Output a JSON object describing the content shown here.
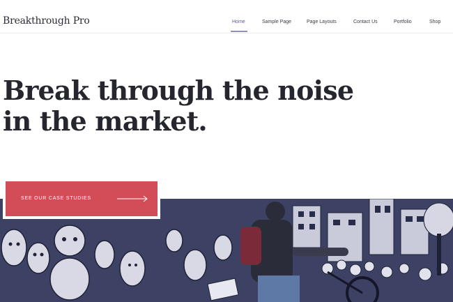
{
  "header": {
    "site_title": "Breakthrough Pro",
    "nav": [
      {
        "label": "Home",
        "active": true
      },
      {
        "label": "Sample Page",
        "active": false
      },
      {
        "label": "Page Layouts",
        "active": false
      },
      {
        "label": "Contact Us",
        "active": false
      },
      {
        "label": "Portfolio",
        "active": false
      },
      {
        "label": "Shop",
        "active": false
      }
    ]
  },
  "hero": {
    "headline_line1": "Break through the noise",
    "headline_line2": "in the market.",
    "cta_label": "SEE OUR CASE STUDIES",
    "cta_icon": "arrow-right-icon",
    "image_description_icon": "mural-photo"
  },
  "colors": {
    "accent": "#d24d57",
    "hero_overlay": "#3b3f62",
    "nav_active": "#5a5f8a",
    "text": "#26262f"
  }
}
